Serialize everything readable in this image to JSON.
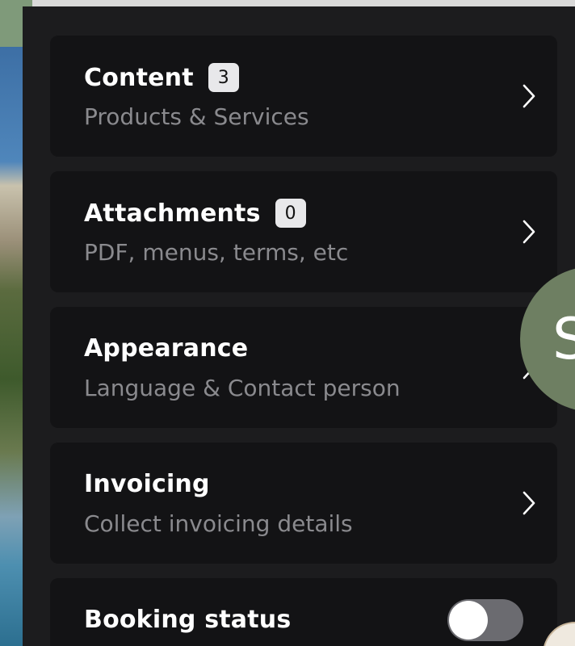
{
  "menu": {
    "items": [
      {
        "title": "Content",
        "badge": "3",
        "subtitle": "Products & Services"
      },
      {
        "title": "Attachments",
        "badge": "0",
        "subtitle": "PDF, menus, terms, etc"
      },
      {
        "title": "Appearance",
        "subtitle": "Language & Contact person"
      },
      {
        "title": "Invoicing",
        "subtitle": "Collect invoicing details"
      }
    ],
    "booking_status": {
      "title": "Booking status",
      "enabled": false
    }
  },
  "avatar": {
    "initial": "S",
    "color": "#6e7f62"
  },
  "colors": {
    "panel_bg": "#1c1c1e",
    "card_bg": "#131315",
    "title": "#ffffff",
    "subtitle": "#8a8a8e",
    "badge_bg": "#e8e8ea",
    "toggle_off": "#6b6b70"
  },
  "icons": {
    "chevron": "chevron-right-icon"
  }
}
